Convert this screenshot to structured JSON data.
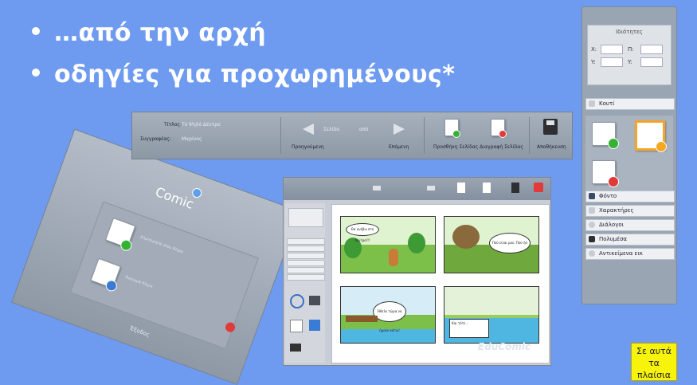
{
  "slide": {
    "bullets": [
      "…από την αρχή",
      "οδηγίες για προχωρημένους*"
    ],
    "note_text": "Σε αυτά τα πλαίσια"
  },
  "right_panel": {
    "properties_title": "Ιδιότητες",
    "x_label": "Χ:",
    "y_label": "Y:",
    "w_label": "Π:",
    "h_label": "Y:",
    "sections": [
      "Κουτί",
      "Φόντο",
      "Χαρακτήρες",
      "Διάλογοι",
      "Πολυμέσα",
      "Αντικείμενα εικ"
    ]
  },
  "toolbar": {
    "title_label": "Τίτλος:",
    "title_value": "Το Ψηλό Δέντρο",
    "author_label": "Συγγραφέας:",
    "author_value": "Μαρίνος",
    "page_label": "Σελίδα",
    "page_of": "από",
    "prev_label": "Προηγούμενη",
    "next_label": "Επόμενη",
    "add_page_label": "Προσθήκη Σελίδας",
    "delete_page_label": "Διαγραφή Σελίδας",
    "save_label": "Αποθήκευση"
  },
  "start_screen": {
    "logo": "Comic",
    "new_label": "Δημιουργία νέου Κόμικ",
    "open_label": "Άνοιγμα Κόμικ",
    "footer": "Έξοδος"
  },
  "editor": {
    "bubble1": "Θα ανέβω στο δέντρο!!!",
    "bubble2": "Πού είναι μου; Πού ήσ",
    "bubble3": "Ήθελε τώρα να ήμουν κάτω!",
    "caption": "Και τότε..."
  },
  "watermark": "EduComic",
  "colors": {
    "background": "#6e9bf0",
    "add_badge": "#34b234",
    "delete_badge": "#e03a3a",
    "highlight_orange": "#f5a623",
    "note_yellow": "#f7f30b"
  }
}
